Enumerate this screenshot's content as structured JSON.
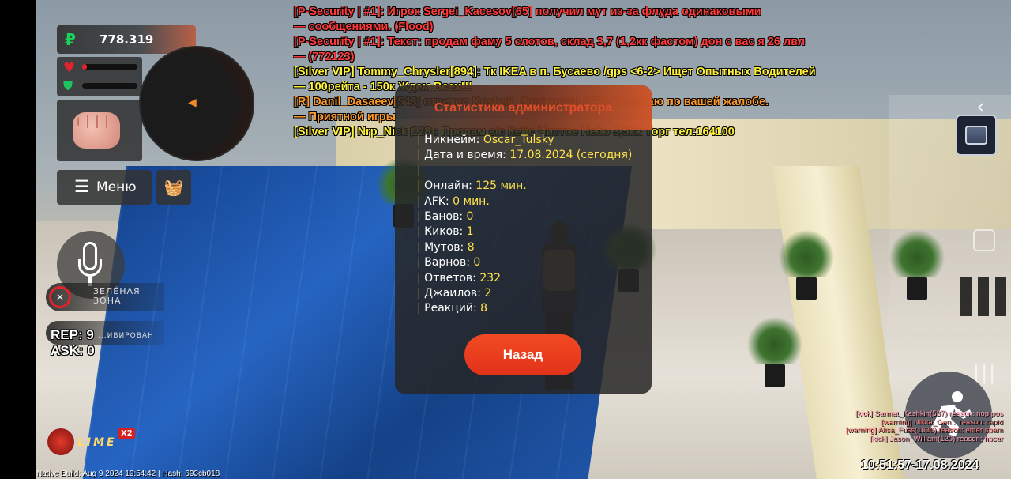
{
  "chat": [
    {
      "text": "[P-Security | #1]: Игрок Sergei_Kacesov[65] получил мут из-за флуда одинаковыми",
      "color": "#ff3b3b"
    },
    {
      "text": "—  сообщениями. (Flood)",
      "color": "#ff3b3b"
    },
    {
      "text": "[P-Security | #1]: Текст: продам фаму 5 слотов, склад 3,7 (1,2кк фастом) дон с вас я 26 лвл",
      "color": "#ff3b3b"
    },
    {
      "text": "—  (772123)",
      "color": "#ff3b3b"
    },
    {
      "text": "[Silver VIP] Tommy_Chrysler[894]: Тк IKEA в п. Бусаево /gps <6-2> Ищет Опытных Водителей",
      "color": "#fff23a"
    },
    {
      "text": "—  100рейта - 150к Ждем Всех!!!",
      "color": "#fff23a"
    },
    {
      "text": "[R] Danil_Dasaeev[543] ответил Koshak_Sanikovich[377]: Работаю по вашей жалобе.",
      "color": "#ff9a2a"
    },
    {
      "text": "—  Приятной игры",
      "color": "#ff9a2a"
    },
    {
      "text": "[Silver VIP] Nrp_Nick[128]: Продам а/с Кейс Чистое Небо 3,5kk Торг тел:164100",
      "color": "#fff23a"
    }
  ],
  "hud": {
    "currency_symbol": "₽",
    "money": "778.319",
    "health_percent": 8,
    "armor_percent": 0,
    "menu_label": "Меню",
    "zone_text_1": "ЗЕЛЁНАЯ",
    "zone_text_2": "ЗОНА",
    "zone2_text": "...ИВИРОВАН",
    "rep": "REP: 9",
    "ask": "ASK: 0",
    "logo_text": "LIME",
    "logo_badge": "X2",
    "build": "Native Build: Aug  9 2024 19:54:42 | Hash: 693cb018",
    "clock": "10:51:57-17.08.2024",
    "icons": {
      "currency": "ruble-icon",
      "health": "heart-icon",
      "armor": "shield-icon",
      "weapon": "fist-icon",
      "menu": "hamburger-icon",
      "shop": "basket-icon",
      "mic": "microphone-icon",
      "zone": "no-weapon-icon",
      "inventory": "chest-icon",
      "sprint": "running-man-icon"
    }
  },
  "kick_feed": [
    "[kick] Sarmat_Kashkin(537) reason: nop pos",
    "[warning] Nikita_Gen... reason: rapid",
    "[warning] Alisa_Fuss(1030) reason: enter spam",
    "[kick] Jason_William(120) reason: hpcar"
  ],
  "dialog": {
    "title": "Статистика администратора",
    "rows": [
      {
        "label": "Никнейм:",
        "value": "Oscar_Tulsky"
      },
      {
        "label": "Дата и время:",
        "value": "17.08.2024 (сегодня)"
      },
      {
        "label": "",
        "value": ""
      },
      {
        "label": "Онлайн:",
        "value": "125 мин."
      },
      {
        "label": "AFK:",
        "value": "0 мин."
      },
      {
        "label": "Банов:",
        "value": "0"
      },
      {
        "label": "Киков:",
        "value": "1"
      },
      {
        "label": "Мутов:",
        "value": "8"
      },
      {
        "label": "Варнов:",
        "value": "0"
      },
      {
        "label": "Ответов:",
        "value": "232"
      },
      {
        "label": "Джаилов:",
        "value": "2"
      },
      {
        "label": "Реакций:",
        "value": "8"
      }
    ],
    "back_label": "Назад"
  }
}
